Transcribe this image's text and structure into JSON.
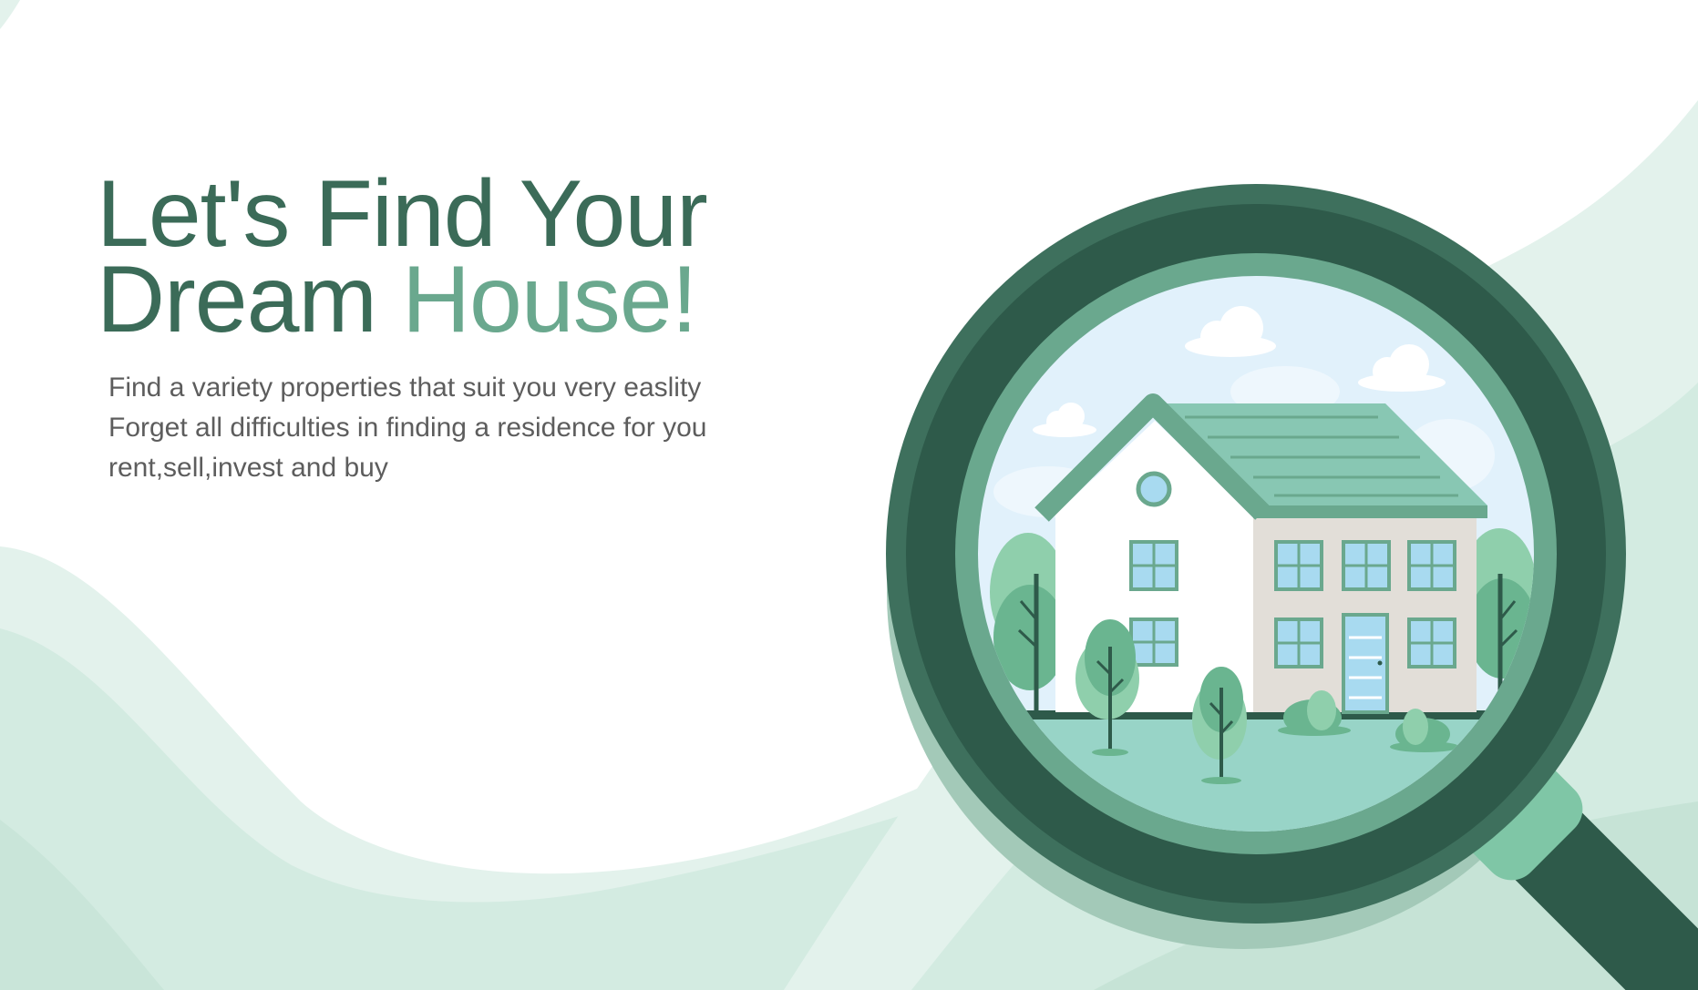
{
  "hero": {
    "title_line1": "Let's Find Your",
    "title_line2_start": "Dream ",
    "title_line2_accent": "House!",
    "subtitle_lines": [
      "Find a variety properties that suit you very easlity",
      "Forget all difficulties in finding a residence for you",
      "rent,sell,invest and buy"
    ]
  },
  "colors": {
    "title_dark": "#3b6b58",
    "title_accent": "#6aa88e",
    "subtitle": "#5d5d5d",
    "magnifier_ring": "#2e5a4a",
    "magnifier_inner_ring": "#6aa88e",
    "magnifier_shadow": "#a3c9b8",
    "handle_light": "#7fc6a6",
    "sky": "#e1f1fb",
    "ground": "#98d4c7",
    "roof": "#88c7b3",
    "house_wall": "#ffffff",
    "house_side": "#e2ded8",
    "window": "#a8daf0",
    "tree_light": "#8fcfac",
    "tree_dark": "#6ab590",
    "wave_light": "#e3f2ec",
    "wave_mid": "#cde8dd"
  },
  "icons": {
    "magnifier": "magnifying-glass-icon",
    "house": "house-icon",
    "trees": "tree-icon",
    "clouds": "cloud-icon"
  }
}
